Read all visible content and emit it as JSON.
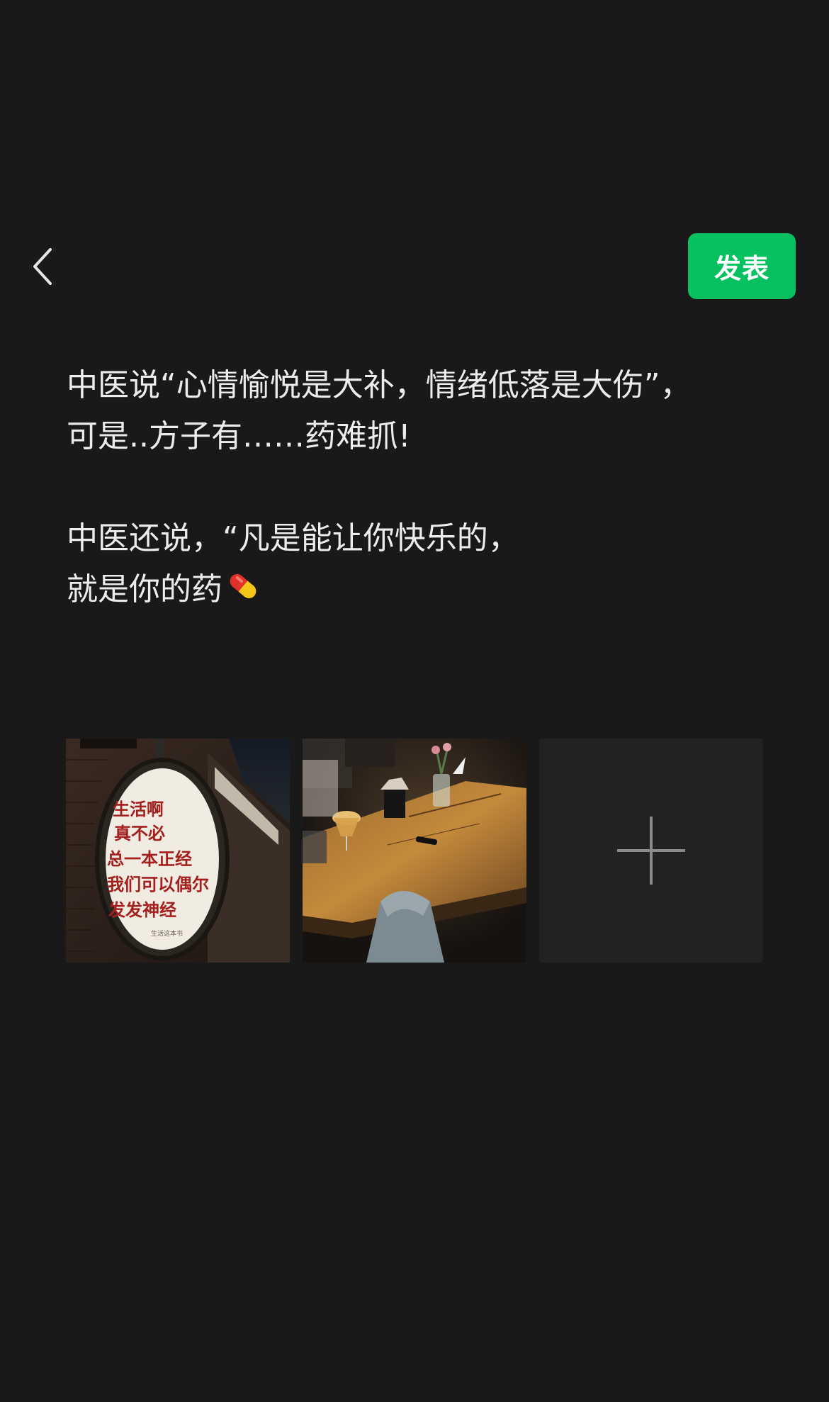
{
  "header": {
    "back_icon": "chevron-left-icon",
    "publish_label": "发表",
    "publish_color": "#07c160"
  },
  "post": {
    "paragraph_1": {
      "line_1": "中医说“心情愉悦是大补，情绪低落是大伤”，",
      "line_2": "可是..方子有……药难抓!"
    },
    "paragraph_2": {
      "line_1": "中医还说，“凡是能让你快乐的，",
      "line_2": "就是你的药",
      "emoji": "pill-emoji"
    }
  },
  "images": [
    {
      "name": "sign-photo",
      "sign_text": [
        "生活啊",
        "真不必",
        "总一本正经",
        "我们可以偶尔",
        "发发神经"
      ],
      "sign_footer": "生活这本书"
    },
    {
      "name": "cafe-table-photo"
    }
  ],
  "add_image": {
    "icon": "plus-icon"
  }
}
